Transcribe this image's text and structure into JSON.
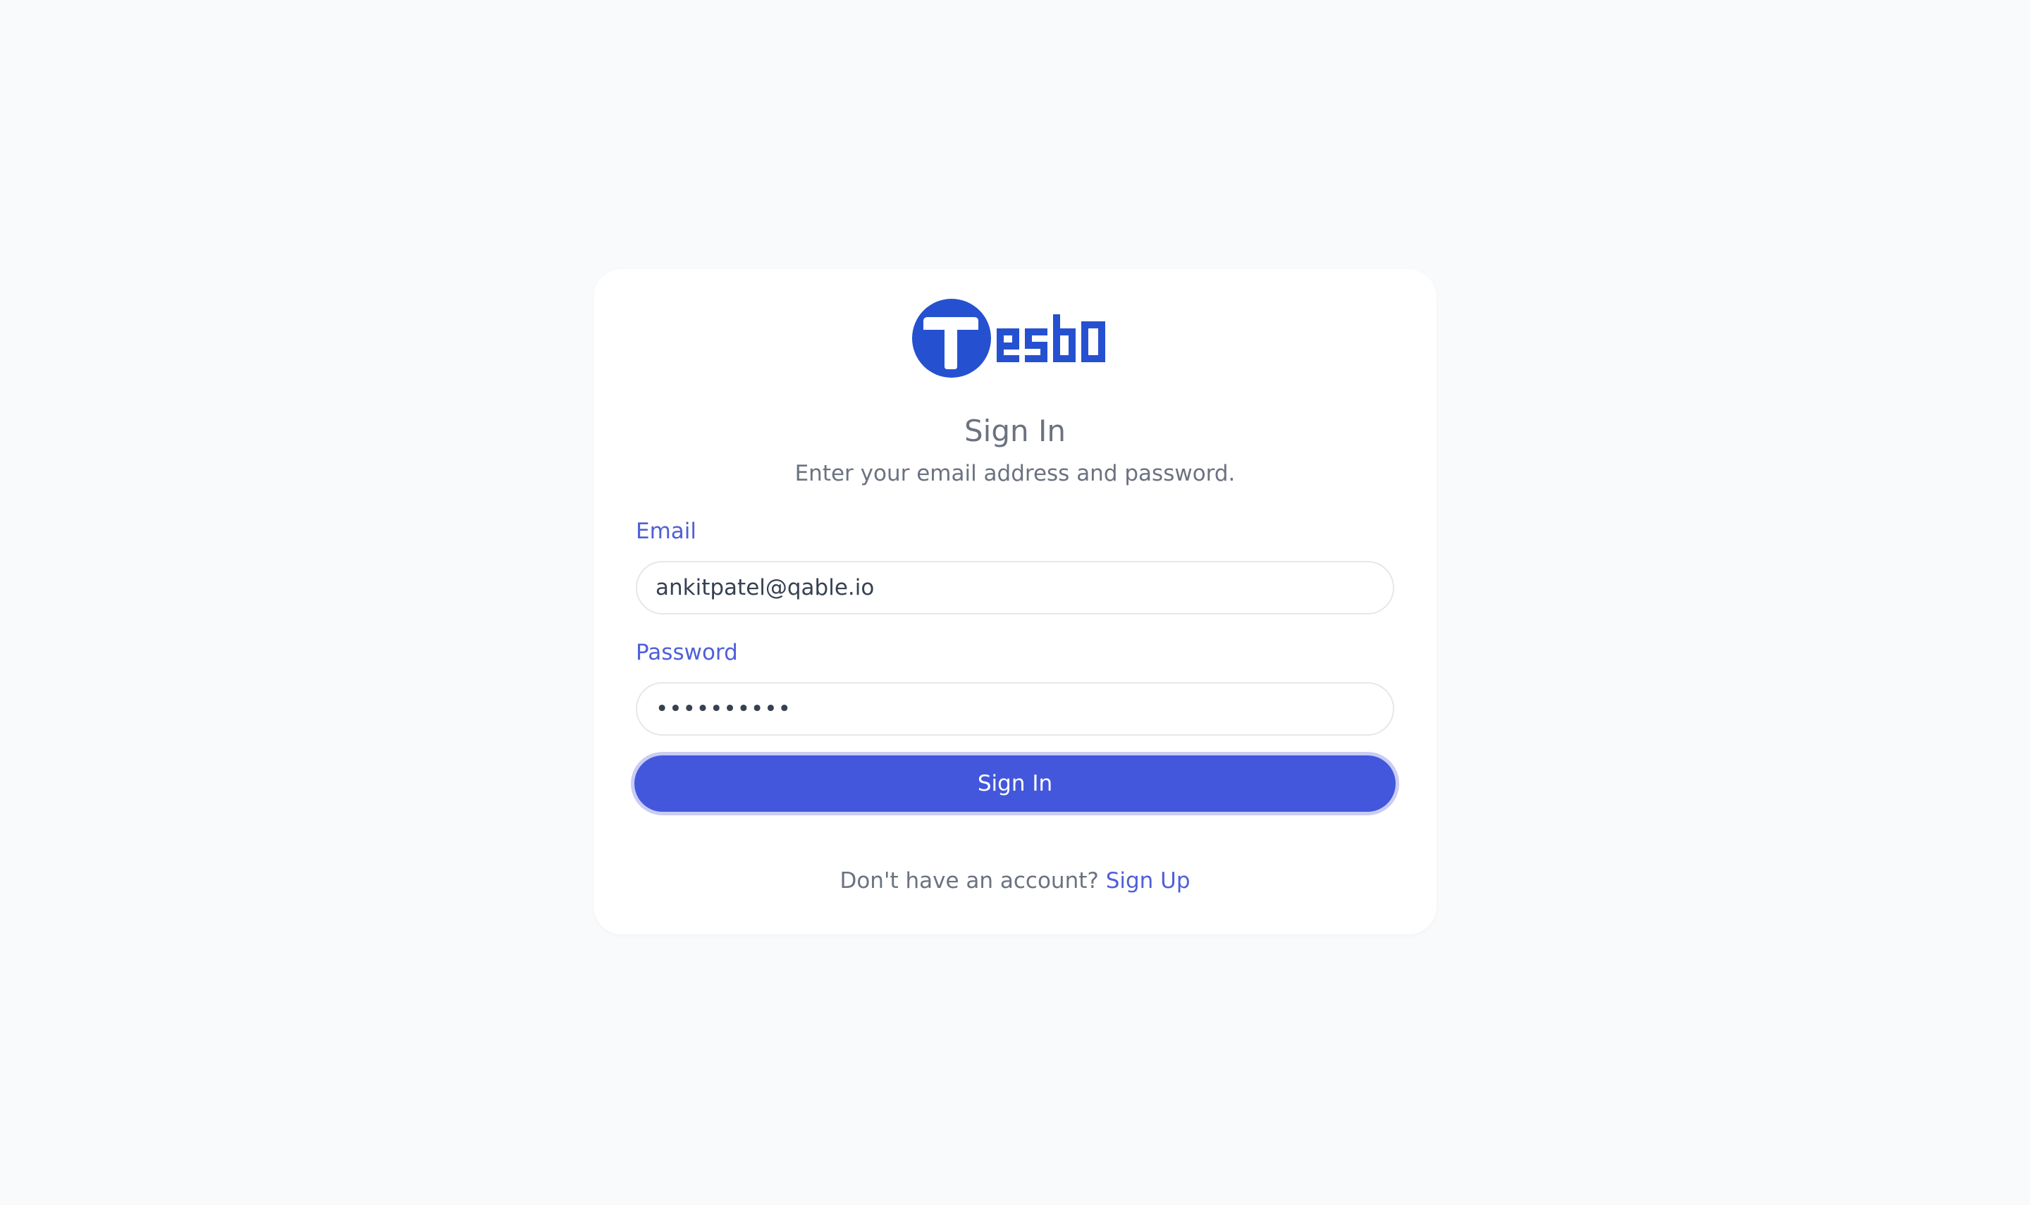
{
  "brand": {
    "logo_icon": "tesbo-logo-icon",
    "logo_color": "#2551d1"
  },
  "header": {
    "title": "Sign In",
    "subtitle": "Enter your email address and password."
  },
  "form": {
    "email_label": "Email",
    "email_value": "ankitpatel@qable.io",
    "password_label": "Password",
    "password_value": "••••••••••",
    "submit_label": "Sign In"
  },
  "footer": {
    "prompt": "Don't have an account?",
    "link_label": "Sign Up"
  },
  "colors": {
    "background": "#f9fafb",
    "accent": "#4357dc",
    "label": "#4f5fd9",
    "muted_text": "#6b7280"
  }
}
